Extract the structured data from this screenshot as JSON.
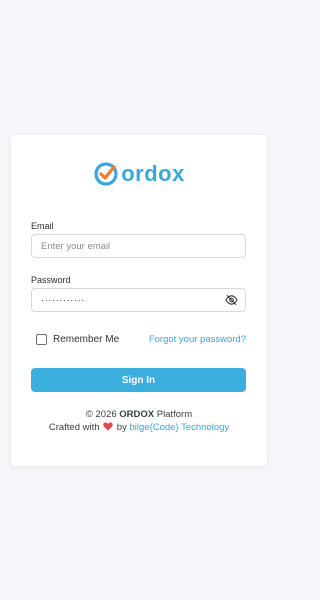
{
  "brand": {
    "name": "ordox",
    "accent_color": "#38a8dc",
    "check_color": "#f07b2e"
  },
  "form": {
    "email_label": "Email",
    "email_placeholder": "Enter your email",
    "email_value": "",
    "password_label": "Password",
    "password_value": "············",
    "password_toggle_icon": "eye-off-icon",
    "remember_label": "Remember Me",
    "remember_checked": false,
    "forgot_label": "Forgot your password?",
    "submit_label": "Sign In"
  },
  "footer": {
    "copyright_prefix": "© 2026",
    "platform_name": "ORDOX",
    "platform_suffix": "Platform",
    "crafted_prefix": "Crafted with",
    "heart_icon": "heart-icon",
    "heart_color": "#e5484d",
    "crafted_by": "by",
    "company_link": "bilge{Code} Technology"
  }
}
